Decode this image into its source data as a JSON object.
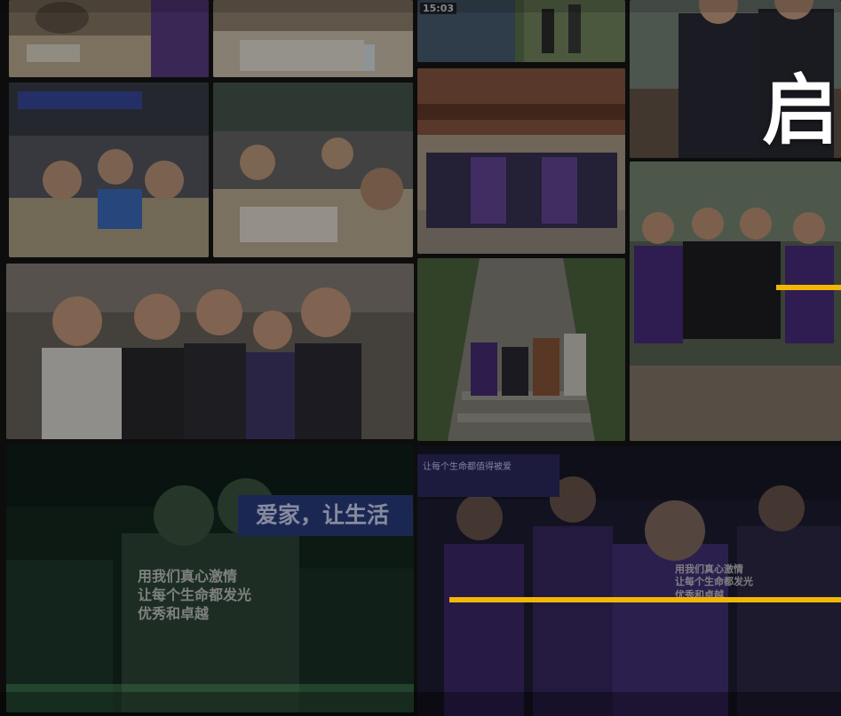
{
  "headline": {
    "char": "启"
  },
  "photo_overlay": {
    "timestamp": "15:03"
  },
  "banners": {
    "left_slogan": "爱家，让生活",
    "right_slogan": "让每个生命都值得被爱"
  },
  "shirt_texts": {
    "left_back": [
      "用我们真心激情",
      "让每个生命都发光",
      "优秀和卓越"
    ],
    "right_back": [
      "用我们真心激情",
      "让每个生命都发光",
      "优秀和卓越"
    ]
  },
  "colors": {
    "accent": "#f2b705",
    "overlay": "#000000",
    "banner_blue": "#2d3f86",
    "shirt_purple": "#4a2d7a"
  },
  "icons": []
}
